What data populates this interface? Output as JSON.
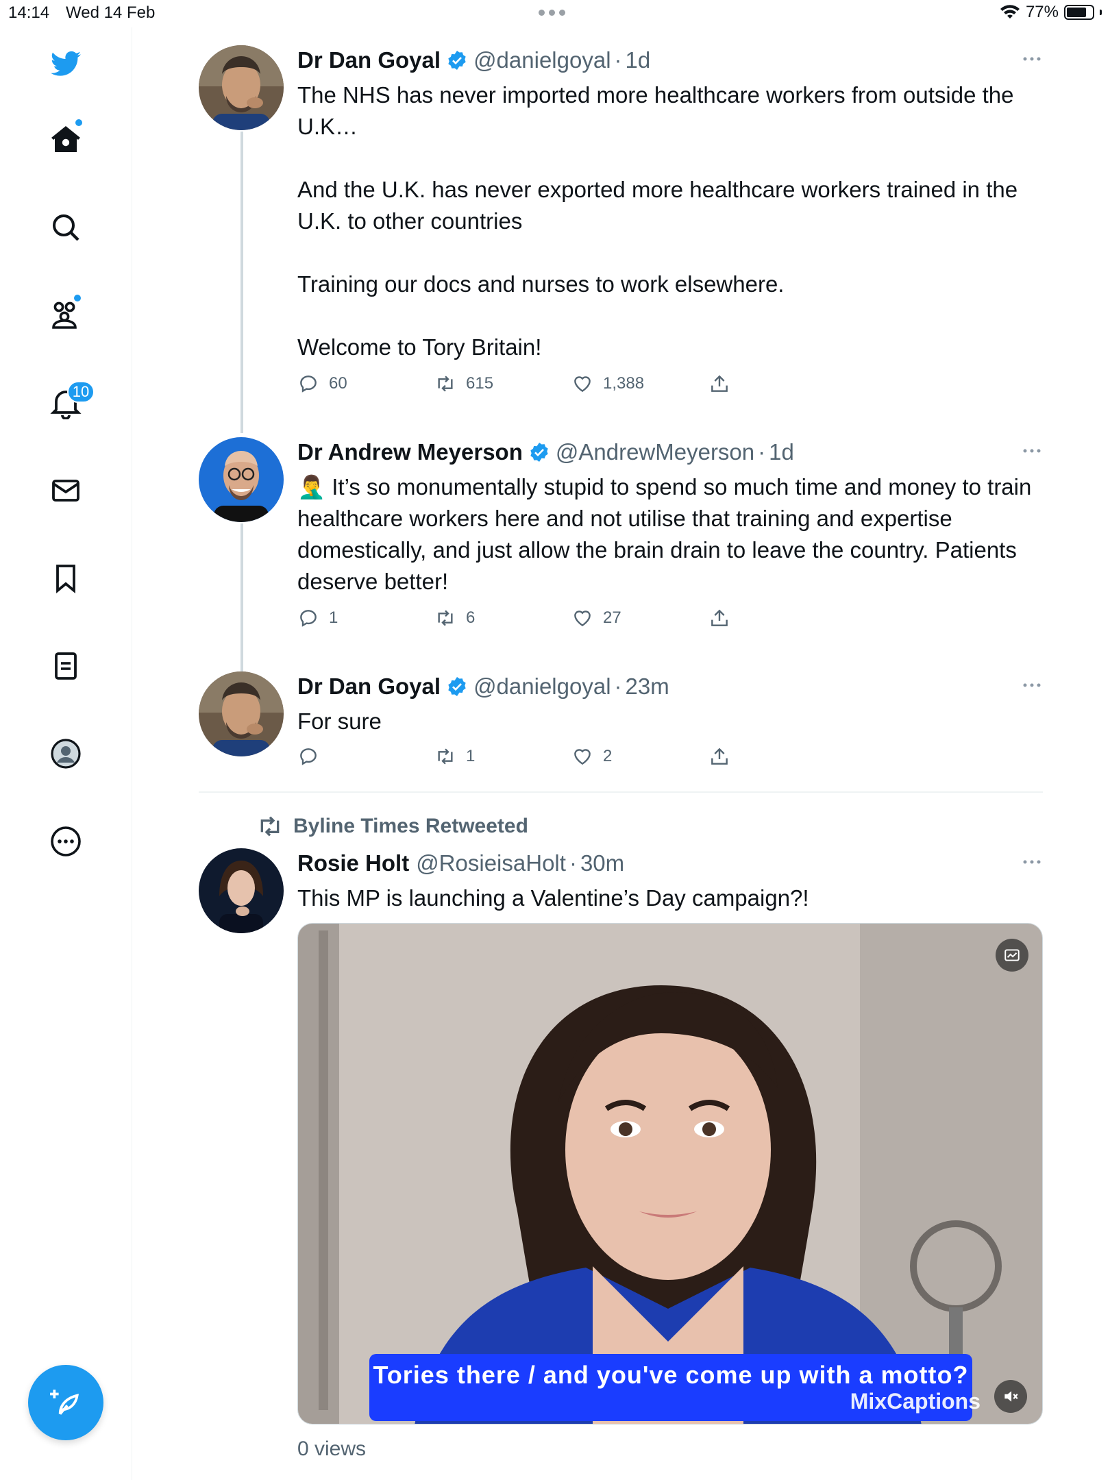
{
  "status_bar": {
    "time": "14:14",
    "date": "Wed 14 Feb",
    "battery": "77%",
    "battery_level": 0.77
  },
  "sidebar": {
    "notifications_badge": "10",
    "items": [
      "twitter-logo",
      "home-icon",
      "search-icon",
      "communities-icon",
      "notifications-icon",
      "messages-icon",
      "bookmarks-icon",
      "lists-icon",
      "profile-icon",
      "more-icon"
    ],
    "compose_icon": "compose-tweet-icon"
  },
  "accent_color": "#1d9bf0",
  "tweets": [
    {
      "name": "Dr Dan Goyal",
      "handle": "@danielgoyal",
      "sep": "·",
      "time": "1d",
      "text": "The NHS has never imported more healthcare workers from outside the U.K…\n\nAnd the U.K. has never exported more healthcare workers trained in the U.K. to other countries\n\nTraining our docs and nurses to work elsewhere.\n\nWelcome to Tory Britain!",
      "replies": "60",
      "retweets": "615",
      "likes": "1,388"
    },
    {
      "name": "Dr Andrew Meyerson",
      "handle": "@AndrewMeyerson",
      "sep": "·",
      "time": "1d",
      "emoji": "🤦‍♂️",
      "text": "It’s so monumentally stupid to spend so much time and money to train healthcare workers here and not utilise that training and expertise domestically, and just allow the brain drain to leave the country. Patients deserve better!",
      "replies": "1",
      "retweets": "6",
      "likes": "27"
    },
    {
      "name": "Dr Dan Goyal",
      "handle": "@danielgoyal",
      "sep": "·",
      "time": "23m",
      "text": "For sure",
      "replies": "",
      "retweets": "1",
      "likes": "2"
    },
    {
      "retweeted_by": "Byline Times Retweeted",
      "name": "Rosie Holt",
      "handle": "@RosieisaHolt",
      "sep": "·",
      "time": "30m",
      "text": "This MP is launching a Valentine’s Day campaign?!",
      "video_caption": "Tories there / and you've come up with a motto?",
      "watermark": "MixCaptions",
      "views": "0 views"
    }
  ]
}
